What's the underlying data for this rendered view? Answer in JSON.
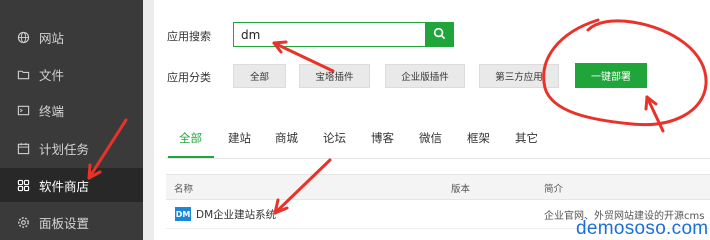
{
  "sidebar": {
    "items": [
      {
        "label": "网站",
        "icon": "globe-icon"
      },
      {
        "label": "文件",
        "icon": "folder-icon"
      },
      {
        "label": "终端",
        "icon": "terminal-icon"
      },
      {
        "label": "计划任务",
        "icon": "calendar-icon"
      },
      {
        "label": "软件商店",
        "icon": "grid-icon",
        "active": true
      },
      {
        "label": "面板设置",
        "icon": "gear-icon"
      }
    ]
  },
  "search": {
    "label": "应用搜索",
    "value": "dm"
  },
  "category": {
    "label": "应用分类",
    "buttons": [
      "全部",
      "宝塔插件",
      "企业版插件",
      "第三方应用"
    ],
    "deploy_label": "一键部署"
  },
  "tabs": [
    "全部",
    "建站",
    "商城",
    "论坛",
    "博客",
    "微信",
    "框架",
    "其它"
  ],
  "table": {
    "headers": [
      "名称",
      "版本",
      "简介"
    ],
    "rows": [
      {
        "logo": "DM",
        "name": "DM企业建站系统",
        "description": "企业官网、外贸网站建设的开源cms"
      }
    ]
  },
  "watermark": "demososo.com",
  "colors": {
    "accent": "#20a53a",
    "annotation": "#e8322a",
    "sidebar": "#3a3a3a"
  }
}
